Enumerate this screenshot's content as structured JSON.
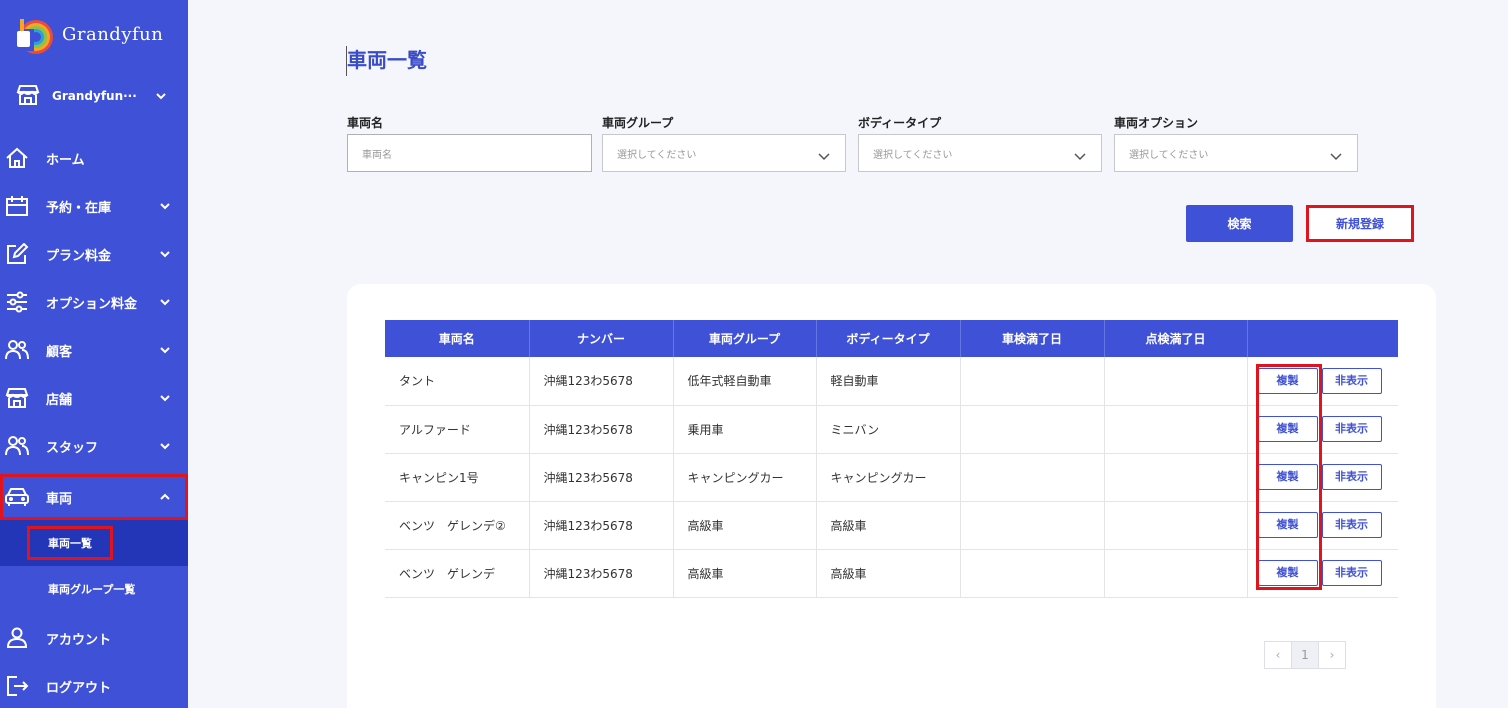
{
  "brand": {
    "name": "Grandyfun"
  },
  "store": {
    "label": "Grandyfun···"
  },
  "nav": [
    {
      "label": "ホーム"
    },
    {
      "label": "予約・在庫"
    },
    {
      "label": "プラン料金"
    },
    {
      "label": "オプション料金"
    },
    {
      "label": "顧客"
    },
    {
      "label": "店舗"
    },
    {
      "label": "スタッフ"
    },
    {
      "label": "車両"
    },
    {
      "label": "アカウント"
    },
    {
      "label": "ログアウト"
    }
  ],
  "subnav": [
    {
      "label": "車両一覧"
    },
    {
      "label": "車両グループ一覧"
    }
  ],
  "page": {
    "title": "車両一覧"
  },
  "filters": {
    "name": {
      "label": "車両名",
      "placeholder": "車両名"
    },
    "group": {
      "label": "車両グループ",
      "placeholder": "選択してください"
    },
    "body": {
      "label": "ボディータイプ",
      "placeholder": "選択してください"
    },
    "option": {
      "label": "車両オプション",
      "placeholder": "選択してください"
    }
  },
  "buttons": {
    "search": "検索",
    "new": "新規登録",
    "copy": "複製",
    "hide": "非表示"
  },
  "table": {
    "headers": [
      "車両名",
      "ナンバー",
      "車両グループ",
      "ボディータイプ",
      "車検満了日",
      "点検満了日",
      ""
    ],
    "rows": [
      [
        "タント",
        "沖縄123わ5678",
        "低年式軽自動車",
        "軽自動車",
        "",
        ""
      ],
      [
        "アルファード",
        "沖縄123わ5678",
        "乗用車",
        "ミニバン",
        "",
        ""
      ],
      [
        "キャンピン1号",
        "沖縄123わ5678",
        "キャンピングカー",
        "キャンピングカー",
        "",
        ""
      ],
      [
        "ベンツ　ゲレンデ②",
        "沖縄123わ5678",
        "高級車",
        "高級車",
        "",
        ""
      ],
      [
        "ベンツ　ゲレンデ",
        "沖縄123わ5678",
        "高級車",
        "高級車",
        "",
        ""
      ]
    ]
  },
  "pagination": {
    "current": "1",
    "prev": "‹",
    "next": "›"
  },
  "colors": {
    "primary": "#3f51d6",
    "highlight": "#e0141d",
    "background": "#f4f6fc"
  }
}
